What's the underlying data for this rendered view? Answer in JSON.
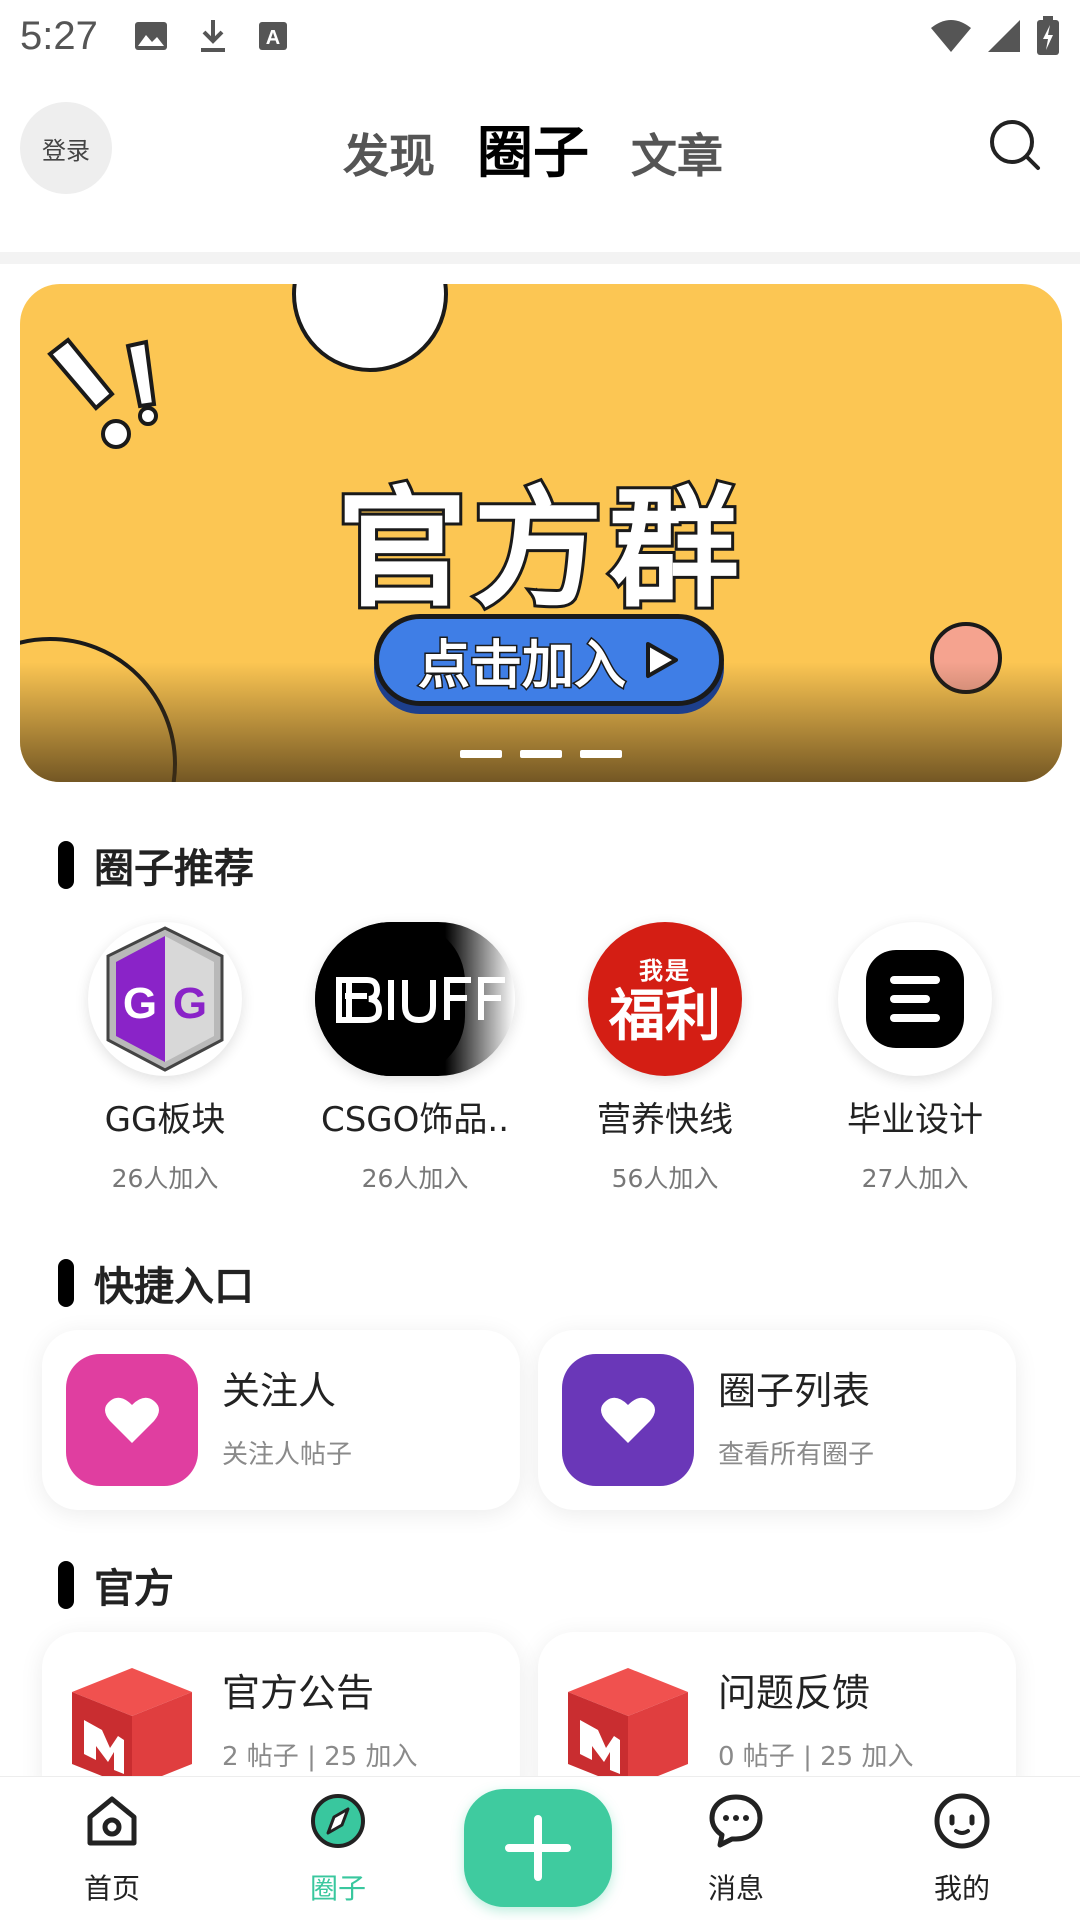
{
  "status_bar": {
    "time": "5:27",
    "left_icons": [
      "image-icon",
      "download-icon",
      "keyboard-a-icon"
    ],
    "right_icons": [
      "wifi-icon",
      "signal-icon",
      "battery-charging-icon"
    ]
  },
  "header": {
    "login_label": "登录",
    "tabs": [
      {
        "label": "发现",
        "active": false
      },
      {
        "label": "圈子",
        "active": true
      },
      {
        "label": "文章",
        "active": false
      }
    ],
    "search_icon": "search-icon"
  },
  "banner": {
    "title": "官方群",
    "cta_label": "点击加入",
    "background_color": "#fcc653",
    "cta_color": "#3f7ee6",
    "dot_count": 3
  },
  "circles_section": {
    "title": "圈子推荐",
    "items": [
      {
        "name": "GG板块",
        "count": "26人加入"
      },
      {
        "name": "CSGO饰品..",
        "count": "26人加入"
      },
      {
        "name": "营养快线",
        "count": "56人加入",
        "logo_text": [
          "我是",
          "福利"
        ]
      },
      {
        "name": "毕业设计",
        "count": "27人加入"
      }
    ]
  },
  "shortcuts_section": {
    "title": "快捷入口",
    "cards": [
      {
        "title": "关注人",
        "subtitle": "关注人帖子",
        "icon": "heart-icon",
        "color": "#e03ea0"
      },
      {
        "title": "圈子列表",
        "subtitle": "查看所有圈子",
        "icon": "heart-icon",
        "color": "#6a37b8"
      }
    ]
  },
  "official_section": {
    "title": "官方",
    "cards": [
      {
        "title": "官方公告",
        "subtitle": "2 帖子 | 25 加入",
        "icon": "m-box-icon"
      },
      {
        "title": "问题反馈",
        "subtitle": "0 帖子 | 25 加入",
        "icon": "m-box-icon"
      }
    ]
  },
  "bottom_nav": {
    "items": [
      {
        "label": "首页",
        "icon": "home-icon",
        "active": false
      },
      {
        "label": "圈子",
        "icon": "compass-icon",
        "active": true
      },
      {
        "label": "消息",
        "icon": "chat-icon",
        "active": false
      },
      {
        "label": "我的",
        "icon": "face-icon",
        "active": false
      }
    ],
    "add_icon": "plus-icon",
    "accent_color": "#3fcb9f"
  }
}
